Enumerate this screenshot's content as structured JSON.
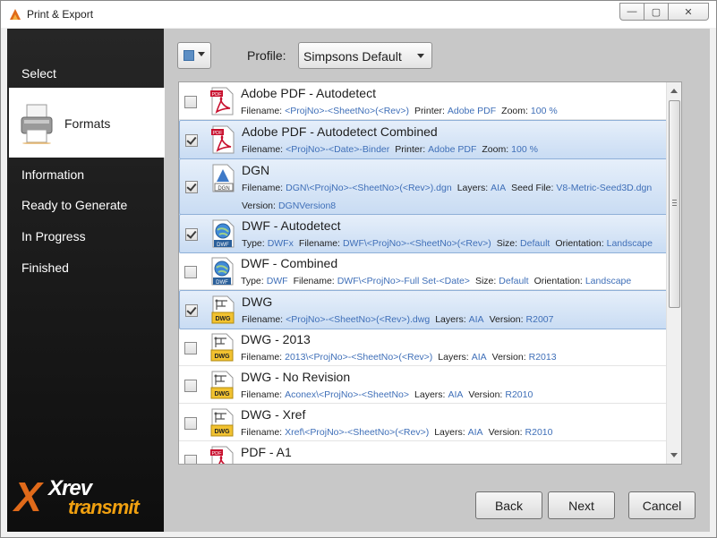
{
  "window": {
    "title": "Print & Export",
    "controls": {
      "minimize": "—",
      "restore": "▢",
      "close": "✕"
    }
  },
  "sidebar": {
    "items": [
      {
        "label": "Select"
      },
      {
        "label": "Formats",
        "active": true
      },
      {
        "label": "Information"
      },
      {
        "label": "Ready to Generate"
      },
      {
        "label": "In Progress"
      },
      {
        "label": "Finished"
      }
    ],
    "logo": {
      "mark": "X",
      "line1": "Xrev",
      "line2": "transmit"
    }
  },
  "toolbar": {
    "profile_label": "Profile:",
    "profile_value": "Simpsons Default"
  },
  "formats": [
    {
      "checked": false,
      "selected": false,
      "icon": "pdf-icon",
      "title": "Adobe PDF - Autodetect",
      "line1": [
        [
          "Filename:",
          "<ProjNo>-<SheetNo>(<Rev>)"
        ],
        [
          "Printer:",
          "Adobe PDF"
        ],
        [
          "Zoom:",
          "100 %"
        ]
      ]
    },
    {
      "checked": true,
      "selected": true,
      "icon": "pdf-icon",
      "title": "Adobe PDF - Autodetect Combined",
      "line1": [
        [
          "Filename:",
          "<ProjNo>-<Date>-Binder"
        ],
        [
          "Printer:",
          "Adobe PDF"
        ],
        [
          "Zoom:",
          "100 %"
        ]
      ]
    },
    {
      "checked": true,
      "selected": true,
      "icon": "dgn-icon",
      "title": "DGN",
      "line1": [
        [
          "Filename:",
          "DGN\\<ProjNo>-<SheetNo>(<Rev>).dgn"
        ],
        [
          "Layers:",
          "AIA"
        ],
        [
          "Seed File:",
          "V8-Metric-Seed3D.dgn"
        ]
      ],
      "line2": [
        [
          "Version:",
          "DGNVersion8"
        ]
      ]
    },
    {
      "checked": true,
      "selected": true,
      "icon": "dwf-icon",
      "title": "DWF - Autodetect",
      "line1": [
        [
          "Type:",
          "DWFx"
        ],
        [
          "Filename:",
          "DWF\\<ProjNo>-<SheetNo>(<Rev>)"
        ],
        [
          "Size:",
          "Default"
        ],
        [
          "Orientation:",
          "Landscape"
        ]
      ]
    },
    {
      "checked": false,
      "selected": false,
      "icon": "dwf-icon",
      "title": "DWF - Combined",
      "line1": [
        [
          "Type:",
          "DWF"
        ],
        [
          "Filename:",
          "DWF\\<ProjNo>-Full Set-<Date>"
        ],
        [
          "Size:",
          "Default"
        ],
        [
          "Orientation:",
          "Landscape"
        ]
      ]
    },
    {
      "checked": true,
      "selected": true,
      "icon": "dwg-icon",
      "title": "DWG",
      "line1": [
        [
          "Filename:",
          "<ProjNo>-<SheetNo>(<Rev>).dwg"
        ],
        [
          "Layers:",
          "AIA"
        ],
        [
          "Version:",
          "R2007"
        ]
      ]
    },
    {
      "checked": false,
      "selected": false,
      "icon": "dwg-icon",
      "title": "DWG - 2013",
      "line1": [
        [
          "Filename:",
          "2013\\<ProjNo>-<SheetNo>(<Rev>)"
        ],
        [
          "Layers:",
          "AIA"
        ],
        [
          "Version:",
          "R2013"
        ]
      ]
    },
    {
      "checked": false,
      "selected": false,
      "icon": "dwg-icon",
      "title": "DWG - No Revision",
      "line1": [
        [
          "Filename:",
          "Aconex\\<ProjNo>-<SheetNo>"
        ],
        [
          "Layers:",
          "AIA"
        ],
        [
          "Version:",
          "R2010"
        ]
      ]
    },
    {
      "checked": false,
      "selected": false,
      "icon": "dwg-icon",
      "title": "DWG - Xref",
      "line1": [
        [
          "Filename:",
          "Xref\\<ProjNo>-<SheetNo>(<Rev>)"
        ],
        [
          "Layers:",
          "AIA"
        ],
        [
          "Version:",
          "R2010"
        ]
      ]
    },
    {
      "checked": false,
      "selected": false,
      "icon": "pdf-icon",
      "title": "PDF - A1",
      "line1": []
    }
  ],
  "icons": {
    "pdf_tag": "PDF",
    "dgn_tag": "DGN",
    "dwf_tag": "DWF",
    "dwg_tag": "DWG"
  },
  "buttons": {
    "back": "Back",
    "next": "Next",
    "cancel": "Cancel"
  }
}
